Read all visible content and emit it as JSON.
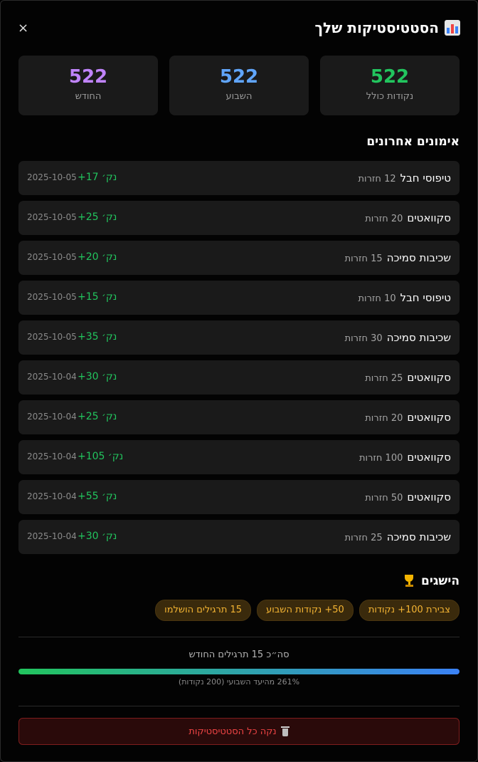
{
  "header": {
    "title": "הסטטיסטיקות שלך",
    "close_label": "×",
    "icon": "bar-chart-icon"
  },
  "stats": [
    {
      "value": "522",
      "label": "נקודות כולל",
      "color": "#22c55e"
    },
    {
      "value": "522",
      "label": "השבוע",
      "color": "#60a5fa"
    },
    {
      "value": "522",
      "label": "החודש",
      "color": "#c084fc"
    }
  ],
  "workouts_title": "אימונים אחרונים",
  "workouts": [
    {
      "name": "טיפוסי חבל",
      "reps": "12 חזרות",
      "points": "+17 נק׳",
      "date": "2025-10-05"
    },
    {
      "name": "סקוואטים",
      "reps": "20 חזרות",
      "points": "+25 נק׳",
      "date": "2025-10-05"
    },
    {
      "name": "שכיבות סמיכה",
      "reps": "15 חזרות",
      "points": "+20 נק׳",
      "date": "2025-10-05"
    },
    {
      "name": "טיפוסי חבל",
      "reps": "10 חזרות",
      "points": "+15 נק׳",
      "date": "2025-10-05"
    },
    {
      "name": "שכיבות סמיכה",
      "reps": "30 חזרות",
      "points": "+35 נק׳",
      "date": "2025-10-05"
    },
    {
      "name": "סקוואטים",
      "reps": "25 חזרות",
      "points": "+30 נק׳",
      "date": "2025-10-04"
    },
    {
      "name": "סקוואטים",
      "reps": "20 חזרות",
      "points": "+25 נק׳",
      "date": "2025-10-04"
    },
    {
      "name": "סקוואטים",
      "reps": "100 חזרות",
      "points": "+105 נק׳",
      "date": "2025-10-04"
    },
    {
      "name": "סקוואטים",
      "reps": "50 חזרות",
      "points": "+55 נק׳",
      "date": "2025-10-04"
    },
    {
      "name": "שכיבות סמיכה",
      "reps": "25 חזרות",
      "points": "+30 נק׳",
      "date": "2025-10-04"
    }
  ],
  "achievements": {
    "title": "הישגים",
    "icon": "trophy-icon",
    "badges": [
      "צבירת 100+ נקודות",
      "50+ נקודות השבוע",
      "15 תרגילים הושלמו"
    ]
  },
  "progress": {
    "month_total": "סה״כ 15 תרגילים החודש",
    "weekly_goal_text": "261% מהיעד השבועי (200 נקודות)",
    "fill_percent": 100,
    "gradient": [
      "#22c55e",
      "#3b82f6"
    ]
  },
  "clear_button": {
    "label": "נקה כל הסטטיסטיקות",
    "icon": "trash-icon"
  }
}
